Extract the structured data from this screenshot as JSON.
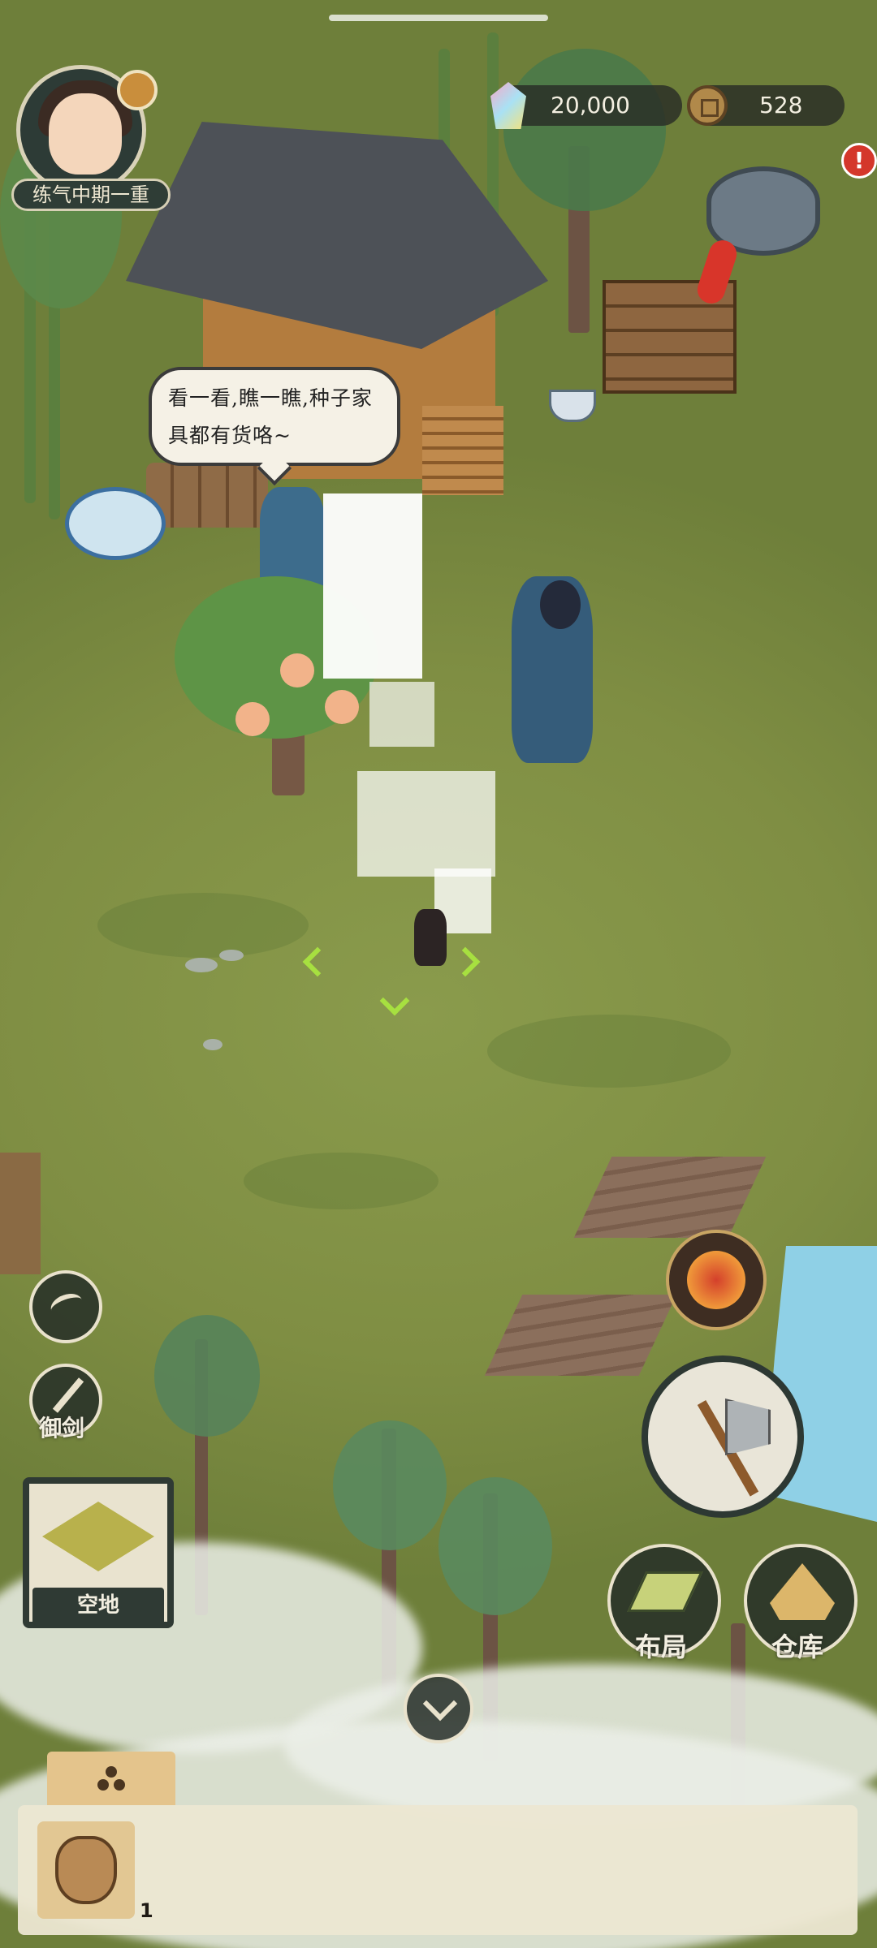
{
  "player": {
    "rank": "练气中期一重"
  },
  "currency": {
    "spirit_stones": "20,000",
    "coins": "528"
  },
  "alert": {
    "mark": "!"
  },
  "npc": {
    "speech": "看一看,瞧一瞧,种子家具都有货咯~"
  },
  "actions": {
    "sword_flight": "御剑",
    "layout": "布局",
    "warehouse": "仓库"
  },
  "selected_tile": {
    "label": "空地"
  },
  "inventory": {
    "items": [
      {
        "icon": "seed-bag-icon",
        "count": "1"
      }
    ]
  },
  "colors": {
    "ground": "#7f8f45",
    "panel_dark": "#2f3a34",
    "alert_red": "#d4372b",
    "inventory_tab": "#e4c48c"
  }
}
